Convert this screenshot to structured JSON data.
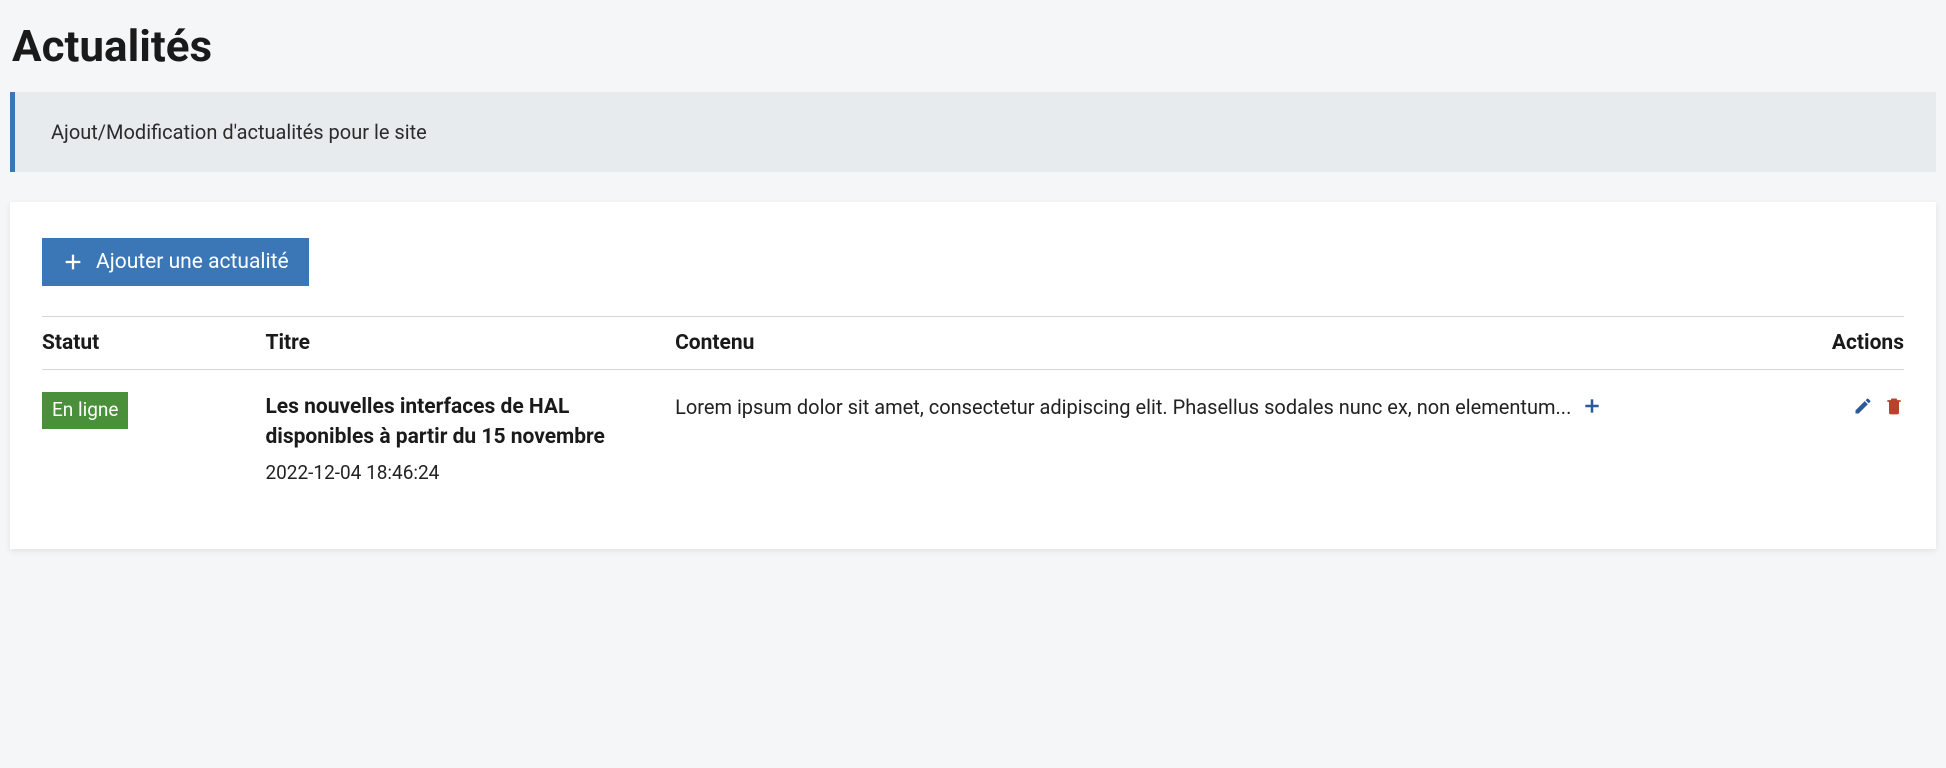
{
  "page": {
    "title": "Actualités",
    "banner": "Ajout/Modification d'actualités pour le site"
  },
  "toolbar": {
    "add_label": "Ajouter une actualité"
  },
  "table": {
    "headers": {
      "status": "Statut",
      "title": "Titre",
      "content": "Contenu",
      "actions": "Actions"
    },
    "rows": [
      {
        "status": "En ligne",
        "title": "Les nouvelles interfaces de HAL disponibles à partir du 15 novembre",
        "date": "2022-12-04 18:46:24",
        "content": "Lorem ipsum dolor sit amet, consectetur adipiscing elit. Phasellus sodales nunc ex, non elementum... "
      }
    ]
  }
}
